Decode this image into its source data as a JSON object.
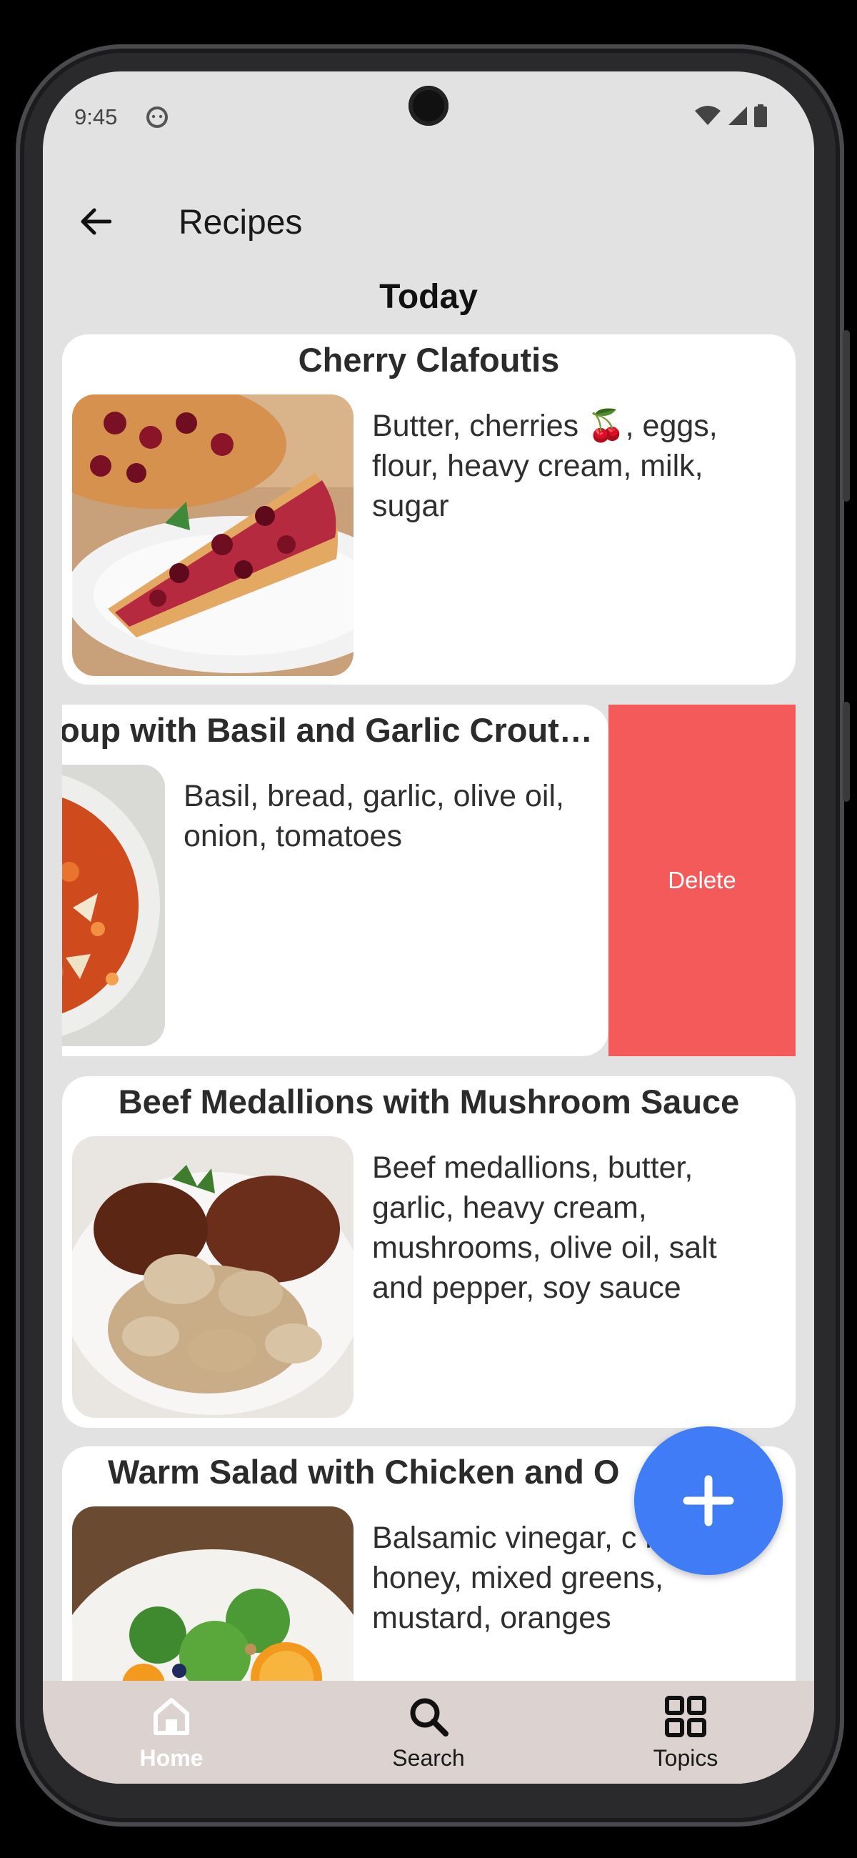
{
  "status_bar": {
    "time": "9:45"
  },
  "header": {
    "title": "Recipes"
  },
  "section": {
    "title": "Today"
  },
  "recipes": [
    {
      "title": "Cherry Clafoutis",
      "ingredients": "Butter, cherries 🍒, eggs, flour, heavy cream, milk, sugar"
    },
    {
      "title": "oup with Basil and Garlic Crout…",
      "ingredients": "Basil, bread, garlic, olive oil, onion, tomatoes",
      "action": "Delete"
    },
    {
      "title": "Beef Medallions with Mushroom Sauce",
      "ingredients": "Beef medallions, butter, garlic, heavy cream, mushrooms, olive oil, salt and pepper, soy sauce"
    },
    {
      "title": "Warm Salad with Chicken and O",
      "ingredients": "Balsamic vinegar, c breast, honey, mixed greens, mustard, oranges"
    }
  ],
  "fab": {
    "icon": "plus-icon"
  },
  "bottom_nav": {
    "items": [
      {
        "label": "Home",
        "icon": "home-icon",
        "active": true
      },
      {
        "label": "Search",
        "icon": "search-icon",
        "active": false
      },
      {
        "label": "Topics",
        "icon": "grid-icon",
        "active": false
      }
    ]
  },
  "colors": {
    "delete": "#f55a5a",
    "fab": "#3f7cf5",
    "nav_bg": "#dcd2cf",
    "screen_bg": "#e2e2e2"
  }
}
